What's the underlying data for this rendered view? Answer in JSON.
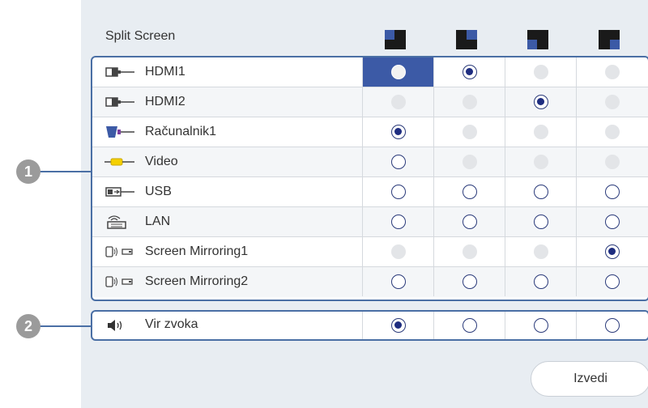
{
  "title": "Split Screen",
  "layouts": [
    {
      "icon": "layout-left-large-icon"
    },
    {
      "icon": "layout-right-large-icon"
    },
    {
      "icon": "layout-left-small-icon"
    },
    {
      "icon": "layout-right-small-icon"
    }
  ],
  "sources": [
    {
      "label": "HDMI1",
      "icon": "hdmi-icon",
      "states": [
        "focused",
        "selected",
        "disabled",
        "disabled"
      ]
    },
    {
      "label": "HDMI2",
      "icon": "hdmi-icon",
      "states": [
        "disabled",
        "disabled",
        "selected",
        "disabled"
      ]
    },
    {
      "label": "Računalnik1",
      "icon": "vga-computer-icon",
      "states": [
        "selected",
        "disabled",
        "disabled",
        "disabled"
      ]
    },
    {
      "label": "Video",
      "icon": "video-rca-icon",
      "states": [
        "empty",
        "disabled",
        "disabled",
        "disabled"
      ]
    },
    {
      "label": "USB",
      "icon": "usb-icon",
      "states": [
        "empty",
        "empty",
        "empty",
        "empty"
      ]
    },
    {
      "label": "LAN",
      "icon": "lan-icon",
      "states": [
        "empty",
        "empty",
        "empty",
        "empty"
      ]
    },
    {
      "label": "Screen Mirroring1",
      "icon": "screen-mirroring-icon",
      "states": [
        "disabled",
        "disabled",
        "disabled",
        "selected"
      ]
    },
    {
      "label": "Screen Mirroring2",
      "icon": "screen-mirroring-icon",
      "states": [
        "empty",
        "empty",
        "empty",
        "empty"
      ]
    }
  ],
  "audio": {
    "label": "Vir zvoka",
    "icon": "speaker-icon",
    "states": [
      "selected",
      "empty",
      "empty",
      "empty"
    ]
  },
  "callouts": [
    "1",
    "2"
  ],
  "execute_label": "Izvedi",
  "colors": {
    "accent": "#3c5aa6",
    "border": "#4a6fa5",
    "panel": "#e8edf2",
    "radio_fill": "#1e2d80"
  }
}
